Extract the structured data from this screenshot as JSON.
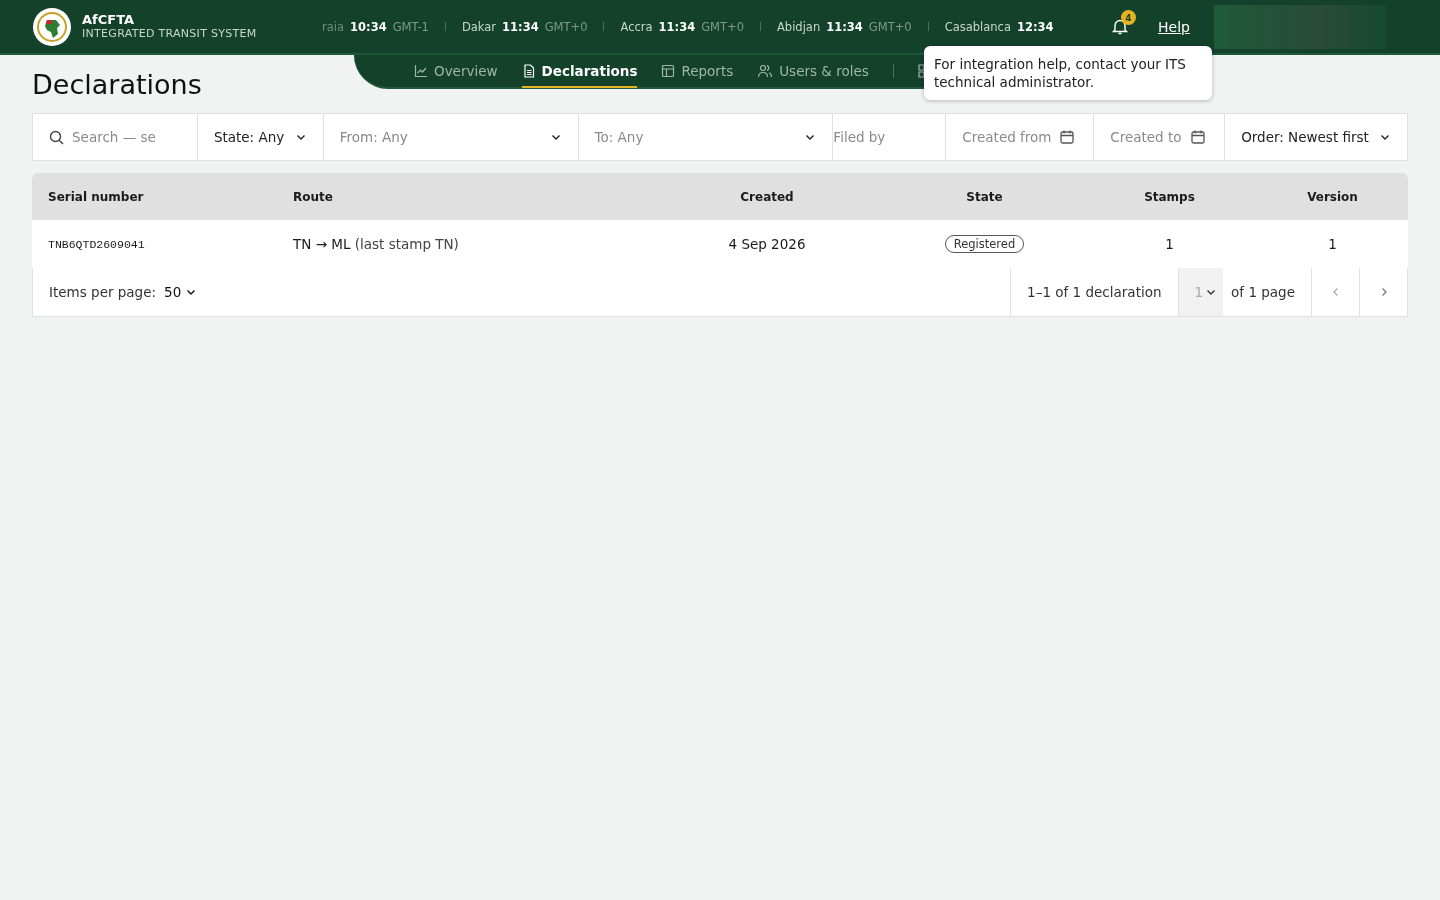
{
  "brand": {
    "name": "AfCFTA",
    "subtitle": "INTEGRATED TRANSIT SYSTEM"
  },
  "clocks": [
    {
      "city": "raia",
      "time": "10:34",
      "zone": "GMT-1"
    },
    {
      "city": "Dakar",
      "time": "11:34",
      "zone": "GMT+0"
    },
    {
      "city": "Accra",
      "time": "11:34",
      "zone": "GMT+0"
    },
    {
      "city": "Abidjan",
      "time": "11:34",
      "zone": "GMT+0"
    },
    {
      "city": "Casablanca",
      "time": "12:34"
    }
  ],
  "notifications": {
    "count": "4"
  },
  "help": {
    "label": "Help"
  },
  "tooltip": {
    "text": "For integration help, contact your ITS technical administrator."
  },
  "page_title": "Declarations",
  "nav_tabs": [
    {
      "label": "Overview",
      "selected": false
    },
    {
      "label": "Declarations",
      "selected": true
    },
    {
      "label": "Reports",
      "selected": false
    },
    {
      "label": "Users & roles",
      "selected": false
    }
  ],
  "filters": [
    {
      "kind": "search",
      "placeholder": "Search — se"
    },
    {
      "kind": "select",
      "value": "State: Any"
    },
    {
      "kind": "select",
      "placeholder": "From: Any"
    },
    {
      "kind": "select",
      "placeholder": "To: Any"
    },
    {
      "kind": "text",
      "placeholder": "Filed by"
    },
    {
      "kind": "date",
      "placeholder": "Created from"
    },
    {
      "kind": "date",
      "placeholder": "Created to"
    },
    {
      "kind": "select",
      "value": "Order: Newest first"
    }
  ],
  "table": {
    "columns": [
      "Serial number",
      "Route",
      "Created",
      "State",
      "Stamps",
      "Version"
    ],
    "rows": [
      {
        "serial": "TNB6QTD2609041",
        "route": "TN → ML",
        "route_note": "(last stamp TN)",
        "created": "4 Sep 2026",
        "state": "Registered",
        "stamps": "1",
        "version": "1"
      }
    ]
  },
  "pagination": {
    "items_label": "Items per page:",
    "items_value": "50",
    "range": "1–1 of 1 declaration",
    "page": "1",
    "pages": "of 1 page"
  }
}
